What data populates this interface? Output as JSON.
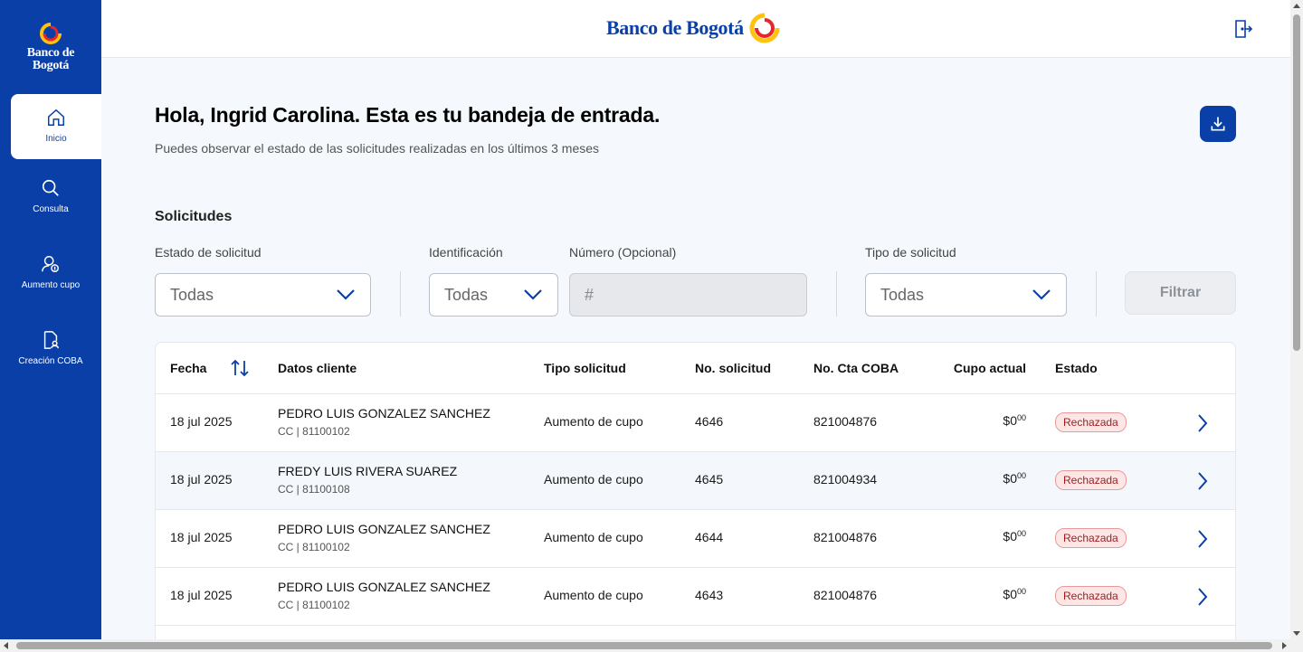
{
  "sidebar": {
    "logo_text_1": "Banco de",
    "logo_text_2": "Bogotá",
    "items": [
      {
        "label": "Inicio",
        "icon": "home-icon",
        "active": true
      },
      {
        "label": "Consulta",
        "icon": "search-icon"
      },
      {
        "label": "Aumento cupo",
        "icon": "user-money-icon"
      },
      {
        "label": "Creación COBA",
        "icon": "document-user-icon"
      }
    ]
  },
  "header": {
    "brand": "Banco de Bogotá",
    "logout_icon": "logout-icon"
  },
  "main": {
    "greeting": "Hola, Ingrid Carolina.  Esta es tu bandeja de entrada.",
    "subtitle": "Puedes observar el estado de las solicitudes realizadas en los últimos 3 meses",
    "download_icon": "download-icon",
    "section_title": "Solicitudes"
  },
  "filters": {
    "estado_label": "Estado de solicitud",
    "estado_value": "Todas",
    "identificacion_label": "Identificación",
    "identificacion_value": "Todas",
    "numero_label": "Número (Opcional)",
    "numero_placeholder": "#",
    "tipo_label": "Tipo de solicitud",
    "tipo_value": "Todas",
    "filter_button": "Filtrar"
  },
  "table": {
    "headers": {
      "fecha": "Fecha",
      "datos": "Datos cliente",
      "tipo": "Tipo solicitud",
      "nosol": "No. solicitud",
      "cta": "No. Cta COBA",
      "cupo": "Cupo actual",
      "estado": "Estado"
    },
    "rows": [
      {
        "fecha": "18 jul 2025",
        "nombre": "PEDRO LUIS GONZALEZ SANCHEZ",
        "ident": "CC | 81100102",
        "tipo": "Aumento de cupo",
        "nosol": "4646",
        "cta": "821004876",
        "cupo_main": "$0",
        "cupo_cents": "00",
        "estado": "Rechazada"
      },
      {
        "fecha": "18 jul 2025",
        "nombre": "FREDY LUIS RIVERA SUAREZ",
        "ident": "CC | 81100108",
        "tipo": "Aumento de cupo",
        "nosol": "4645",
        "cta": "821004934",
        "cupo_main": "$0",
        "cupo_cents": "00",
        "estado": "Rechazada"
      },
      {
        "fecha": "18 jul 2025",
        "nombre": "PEDRO LUIS GONZALEZ SANCHEZ",
        "ident": "CC | 81100102",
        "tipo": "Aumento de cupo",
        "nosol": "4644",
        "cta": "821004876",
        "cupo_main": "$0",
        "cupo_cents": "00",
        "estado": "Rechazada"
      },
      {
        "fecha": "18 jul 2025",
        "nombre": "PEDRO LUIS GONZALEZ SANCHEZ",
        "ident": "CC | 81100102",
        "tipo": "Aumento de cupo",
        "nosol": "4643",
        "cta": "821004876",
        "cupo_main": "$0",
        "cupo_cents": "00",
        "estado": "Rechazada"
      }
    ]
  },
  "colors": {
    "primary": "#0a3fa8",
    "badge_text": "#9e1c1c",
    "badge_bg": "#fde6e6"
  }
}
